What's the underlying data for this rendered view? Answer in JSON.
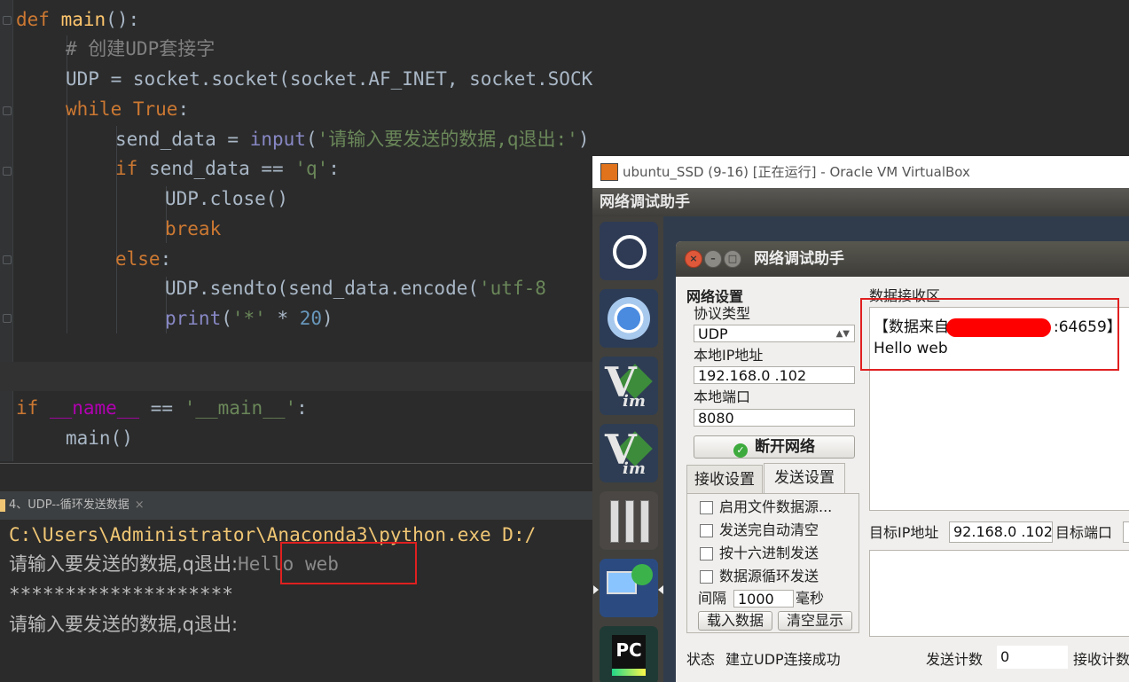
{
  "editor": {
    "lines": {
      "l1": {
        "kw": "def",
        "fn": "main",
        "rest": "():"
      },
      "l2": {
        "comment": "# 创建UDP套接字"
      },
      "l3": {
        "a": "UDP = socket.socket(socket.AF_INET, socket.SOCK_DGRAM)"
      },
      "l4": {
        "kw": "while",
        "kw2": "True",
        "rest": ":"
      },
      "l5": {
        "a": "send_data = ",
        "bi": "input",
        "b": "(",
        "str": "'请输入要发送的数据,q退出:'",
        "c": ")"
      },
      "l6": {
        "kw": "if",
        "a": " send_data == ",
        "str": "'q'",
        "c": ":"
      },
      "l7": {
        "a": "UDP.close()"
      },
      "l8": {
        "kw": "break"
      },
      "l9": {
        "kw": "else",
        "rest": ":"
      },
      "l10": {
        "a": "UDP.sendto(send_data.encode(",
        "str": "'utf-8"
      },
      "l11": {
        "bi": "print",
        "b": "(",
        "str": "'*'",
        "op": " * ",
        "num": "20",
        "c": ")"
      },
      "l12": {
        "kw": "if",
        "mg": "__name__",
        "op": " == ",
        "str": "'__main__'",
        "c": ":"
      },
      "l13": {
        "a": "main()"
      }
    }
  },
  "run": {
    "tab_label": "4、UDP--循环发送数据",
    "tab_close": "×",
    "path_line": "C:\\Users\\Administrator\\Anaconda3\\python.exe D:/",
    "prompt1": "请输入要发送的数据,q退出:",
    "input1": "Hello web",
    "stars": "********************",
    "prompt2": "请输入要发送的数据,q退出:"
  },
  "vbox": {
    "title": "ubuntu_SSD (9-16) [正在运行] - Oracle VM VirtualBox",
    "topbar_title": "网络调试助手"
  },
  "app": {
    "title": "网络调试助手",
    "network_settings": "网络设置",
    "protocol_label": "协议类型",
    "protocol_value": "UDP",
    "local_ip_label": "本地IP地址",
    "local_ip_value": "192.168.0 .102",
    "local_port_label": "本地端口",
    "local_port_value": "8080",
    "disconnect_button": "断开网络",
    "tabs": {
      "recv": "接收设置",
      "send": "发送设置"
    },
    "send_options": [
      "启用文件数据源...",
      "发送完自动清空",
      "按十六进制发送",
      "数据源循环发送"
    ],
    "interval_label": "间隔",
    "interval_value": "1000",
    "interval_unit": "毫秒",
    "load_data_button": "载入数据",
    "clear_display_button": "清空显示",
    "recv_area_label": "数据接收区",
    "recv_prefix": "【数据来自",
    "recv_suffix": ":64659】",
    "recv_message": "Hello web",
    "target_ip_label": "目标IP地址",
    "target_ip_value": "92.168.0 .102",
    "target_port_label": "目标端口",
    "status_label": "状态",
    "status_value": "建立UDP连接成功",
    "send_count_label": "发送计数",
    "send_count_value": "0",
    "recv_count_label": "接收计数"
  }
}
